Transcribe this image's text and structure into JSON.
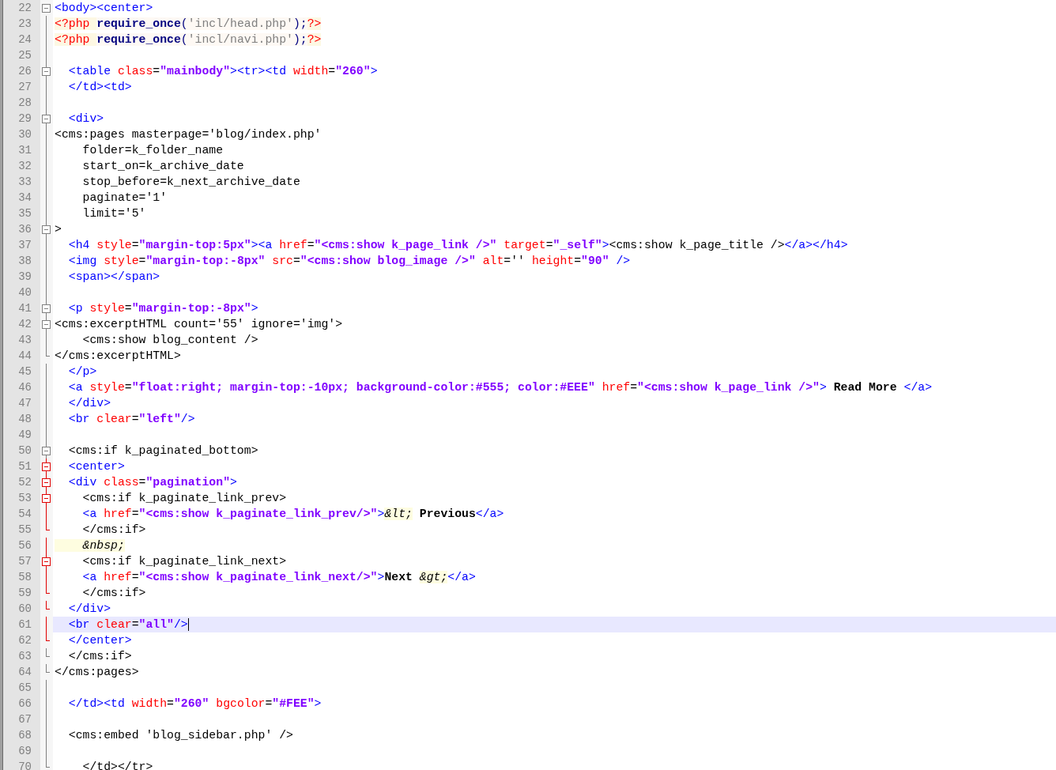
{
  "editor": {
    "lines": [
      {
        "number": "22",
        "fold": {
          "kind": "box",
          "in_scope": false
        },
        "current": false,
        "tokens": [
          {
            "kind": "tag",
            "text": "<body><center>"
          }
        ]
      },
      {
        "number": "23",
        "fold": {
          "kind": "line",
          "in_scope": false
        },
        "current": false,
        "tokens": [
          {
            "kind": "php",
            "text": "<?php "
          },
          {
            "kind": "keyword",
            "text": "require_once"
          },
          {
            "kind": "phpop",
            "text": "("
          },
          {
            "kind": "phpstr",
            "text": "'incl/head.php'"
          },
          {
            "kind": "phpop",
            "text": ");"
          },
          {
            "kind": "php",
            "text": "?>"
          }
        ]
      },
      {
        "number": "24",
        "fold": {
          "kind": "line",
          "in_scope": false
        },
        "current": false,
        "tokens": [
          {
            "kind": "php",
            "text": "<?php "
          },
          {
            "kind": "keyword",
            "text": "require_once"
          },
          {
            "kind": "phpop",
            "text": "("
          },
          {
            "kind": "phpstr",
            "text": "'incl/navi.php'"
          },
          {
            "kind": "phpop",
            "text": ");"
          },
          {
            "kind": "php",
            "text": "?>"
          }
        ]
      },
      {
        "number": "25",
        "fold": {
          "kind": "line",
          "in_scope": false
        },
        "current": false
      },
      {
        "number": "26",
        "fold": {
          "kind": "box",
          "in_scope": false
        },
        "current": false,
        "tokens": [
          {
            "kind": "tag",
            "text": "  <table"
          },
          {
            "kind": "attr",
            "text": " class"
          },
          {
            "kind": "text",
            "text": "="
          },
          {
            "kind": "str",
            "text": "\"mainbody\""
          },
          {
            "kind": "tag",
            "text": "><tr><td"
          },
          {
            "kind": "attr",
            "text": " width"
          },
          {
            "kind": "text",
            "text": "="
          },
          {
            "kind": "str",
            "text": "\"260\""
          },
          {
            "kind": "tag",
            "text": ">"
          }
        ]
      },
      {
        "number": "27",
        "fold": {
          "kind": "line",
          "in_scope": false
        },
        "current": false,
        "tokens": [
          {
            "kind": "tag",
            "text": "  </td><td>"
          }
        ]
      },
      {
        "number": "28",
        "fold": {
          "kind": "line",
          "in_scope": false
        },
        "current": false
      },
      {
        "number": "29",
        "fold": {
          "kind": "box",
          "in_scope": false
        },
        "current": false,
        "tokens": [
          {
            "kind": "tag",
            "text": "  <div>"
          }
        ]
      },
      {
        "number": "30",
        "fold": {
          "kind": "line",
          "in_scope": false
        },
        "current": false,
        "tokens": [
          {
            "kind": "text",
            "text": "<cms:pages masterpage='blog/index.php'"
          }
        ]
      },
      {
        "number": "31",
        "fold": {
          "kind": "line",
          "in_scope": false
        },
        "current": false,
        "tokens": [
          {
            "kind": "text",
            "text": "    folder=k_folder_name"
          }
        ]
      },
      {
        "number": "32",
        "fold": {
          "kind": "line",
          "in_scope": false
        },
        "current": false,
        "tokens": [
          {
            "kind": "text",
            "text": "    start_on=k_archive_date"
          }
        ]
      },
      {
        "number": "33",
        "fold": {
          "kind": "line",
          "in_scope": false
        },
        "current": false,
        "tokens": [
          {
            "kind": "text",
            "text": "    stop_before=k_next_archive_date"
          }
        ]
      },
      {
        "number": "34",
        "fold": {
          "kind": "line",
          "in_scope": false
        },
        "current": false,
        "tokens": [
          {
            "kind": "text",
            "text": "    paginate='1'"
          }
        ]
      },
      {
        "number": "35",
        "fold": {
          "kind": "line",
          "in_scope": false
        },
        "current": false,
        "tokens": [
          {
            "kind": "text",
            "text": "    limit='5'"
          }
        ]
      },
      {
        "number": "36",
        "fold": {
          "kind": "box",
          "in_scope": false
        },
        "current": false,
        "tokens": [
          {
            "kind": "text",
            "text": ">"
          }
        ]
      },
      {
        "number": "37",
        "fold": {
          "kind": "line",
          "in_scope": false
        },
        "current": false,
        "tokens": [
          {
            "kind": "tag",
            "text": "  <h4"
          },
          {
            "kind": "attr",
            "text": " style"
          },
          {
            "kind": "text",
            "text": "="
          },
          {
            "kind": "str",
            "text": "\"margin-top:5px\""
          },
          {
            "kind": "tag",
            "text": "><a"
          },
          {
            "kind": "attr",
            "text": " href"
          },
          {
            "kind": "text",
            "text": "="
          },
          {
            "kind": "str",
            "text": "\"<cms:show k_page_link />\""
          },
          {
            "kind": "attr",
            "text": " target"
          },
          {
            "kind": "text",
            "text": "="
          },
          {
            "kind": "str",
            "text": "\"_self\""
          },
          {
            "kind": "tag",
            "text": ">"
          },
          {
            "kind": "text",
            "text": "<cms:show k_page_title />"
          },
          {
            "kind": "tag",
            "text": "</a></h4>"
          }
        ]
      },
      {
        "number": "38",
        "fold": {
          "kind": "line",
          "in_scope": false
        },
        "current": false,
        "tokens": [
          {
            "kind": "tag",
            "text": "  <img"
          },
          {
            "kind": "attr",
            "text": " style"
          },
          {
            "kind": "text",
            "text": "="
          },
          {
            "kind": "str",
            "text": "\"margin-top:-8px\""
          },
          {
            "kind": "attr",
            "text": " src"
          },
          {
            "kind": "text",
            "text": "="
          },
          {
            "kind": "str",
            "text": "\"<cms:show blog_image />\""
          },
          {
            "kind": "attr",
            "text": " alt"
          },
          {
            "kind": "text",
            "text": "=''"
          },
          {
            "kind": "attr",
            "text": " height"
          },
          {
            "kind": "text",
            "text": "="
          },
          {
            "kind": "str",
            "text": "\"90\""
          },
          {
            "kind": "tag",
            "text": " />"
          }
        ]
      },
      {
        "number": "39",
        "fold": {
          "kind": "line",
          "in_scope": false
        },
        "current": false,
        "tokens": [
          {
            "kind": "tag",
            "text": "  <span></span>"
          }
        ]
      },
      {
        "number": "40",
        "fold": {
          "kind": "line",
          "in_scope": false
        },
        "current": false
      },
      {
        "number": "41",
        "fold": {
          "kind": "box",
          "in_scope": false
        },
        "current": false,
        "tokens": [
          {
            "kind": "tag",
            "text": "  <p"
          },
          {
            "kind": "attr",
            "text": " style"
          },
          {
            "kind": "text",
            "text": "="
          },
          {
            "kind": "str",
            "text": "\"margin-top:-8px\""
          },
          {
            "kind": "tag",
            "text": ">"
          }
        ]
      },
      {
        "number": "42",
        "fold": {
          "kind": "box",
          "in_scope": false
        },
        "current": false,
        "tokens": [
          {
            "kind": "text",
            "text": "<cms:excerptHTML count='55' ignore='img'>"
          }
        ]
      },
      {
        "number": "43",
        "fold": {
          "kind": "line",
          "in_scope": false
        },
        "current": false,
        "tokens": [
          {
            "kind": "text",
            "text": "    <cms:show blog_content />"
          }
        ]
      },
      {
        "number": "44",
        "fold": {
          "kind": "end",
          "in_scope": false
        },
        "current": false,
        "tokens": [
          {
            "kind": "text",
            "text": "</cms:excerptHTML>"
          }
        ]
      },
      {
        "number": "45",
        "fold": {
          "kind": "line",
          "in_scope": false
        },
        "current": false,
        "tokens": [
          {
            "kind": "tag",
            "text": "  </p>"
          }
        ]
      },
      {
        "number": "46",
        "fold": {
          "kind": "line",
          "in_scope": false
        },
        "current": false,
        "tokens": [
          {
            "kind": "tag",
            "text": "  <a"
          },
          {
            "kind": "attr",
            "text": " style"
          },
          {
            "kind": "text",
            "text": "="
          },
          {
            "kind": "str",
            "text": "\"float:right; margin-top:-10px; background-color:#555; color:#EEE\""
          },
          {
            "kind": "attr",
            "text": " href"
          },
          {
            "kind": "text",
            "text": "="
          },
          {
            "kind": "str",
            "text": "\"<cms:show k_page_link />\""
          },
          {
            "kind": "tag",
            "text": ">"
          },
          {
            "kind": "bold",
            "text": " Read More "
          },
          {
            "kind": "tag",
            "text": "</a>"
          }
        ]
      },
      {
        "number": "47",
        "fold": {
          "kind": "line",
          "in_scope": false
        },
        "current": false,
        "tokens": [
          {
            "kind": "tag",
            "text": "  </div>"
          }
        ]
      },
      {
        "number": "48",
        "fold": {
          "kind": "line",
          "in_scope": false
        },
        "current": false,
        "tokens": [
          {
            "kind": "tag",
            "text": "  <br"
          },
          {
            "kind": "attr",
            "text": " clear"
          },
          {
            "kind": "text",
            "text": "="
          },
          {
            "kind": "str",
            "text": "\"left\""
          },
          {
            "kind": "tag",
            "text": "/>"
          }
        ]
      },
      {
        "number": "49",
        "fold": {
          "kind": "line",
          "in_scope": false
        },
        "current": false
      },
      {
        "number": "50",
        "fold": {
          "kind": "box",
          "in_scope": false
        },
        "current": false,
        "tokens": [
          {
            "kind": "text",
            "text": "  <cms:if k_paginated_bottom>"
          }
        ]
      },
      {
        "number": "51",
        "fold": {
          "kind": "box",
          "in_scope": true
        },
        "current": false,
        "tokens": [
          {
            "kind": "tag",
            "text": "  <center>"
          }
        ]
      },
      {
        "number": "52",
        "fold": {
          "kind": "box",
          "in_scope": true
        },
        "current": false,
        "tokens": [
          {
            "kind": "tag",
            "text": "  <div"
          },
          {
            "kind": "attr",
            "text": " class"
          },
          {
            "kind": "text",
            "text": "="
          },
          {
            "kind": "str",
            "text": "\"pagination\""
          },
          {
            "kind": "tag",
            "text": ">"
          }
        ]
      },
      {
        "number": "53",
        "fold": {
          "kind": "box",
          "in_scope": true
        },
        "current": false,
        "tokens": [
          {
            "kind": "text",
            "text": "    <cms:if k_paginate_link_prev>"
          }
        ]
      },
      {
        "number": "54",
        "fold": {
          "kind": "line",
          "in_scope": true
        },
        "current": false,
        "tokens": [
          {
            "kind": "tag",
            "text": "    <a"
          },
          {
            "kind": "attr",
            "text": " href"
          },
          {
            "kind": "text",
            "text": "="
          },
          {
            "kind": "str",
            "text": "\"<cms:show k_paginate_link_prev/>\""
          },
          {
            "kind": "tag",
            "text": ">"
          },
          {
            "kind": "entity",
            "text": "&lt;"
          },
          {
            "kind": "bold",
            "text": " Previous"
          },
          {
            "kind": "tag",
            "text": "</a>"
          }
        ]
      },
      {
        "number": "55",
        "fold": {
          "kind": "end",
          "in_scope": true
        },
        "current": false,
        "tokens": [
          {
            "kind": "text",
            "text": "    </cms:if>"
          }
        ]
      },
      {
        "number": "56",
        "fold": {
          "kind": "line",
          "in_scope": true
        },
        "current": false,
        "tokens": [
          {
            "kind": "entity",
            "text": "    &nbsp;"
          }
        ]
      },
      {
        "number": "57",
        "fold": {
          "kind": "box",
          "in_scope": true
        },
        "current": false,
        "tokens": [
          {
            "kind": "text",
            "text": "    <cms:if k_paginate_link_next>"
          }
        ]
      },
      {
        "number": "58",
        "fold": {
          "kind": "line",
          "in_scope": true
        },
        "current": false,
        "tokens": [
          {
            "kind": "tag",
            "text": "    <a"
          },
          {
            "kind": "attr",
            "text": " href"
          },
          {
            "kind": "text",
            "text": "="
          },
          {
            "kind": "str",
            "text": "\"<cms:show k_paginate_link_next/>\""
          },
          {
            "kind": "tag",
            "text": ">"
          },
          {
            "kind": "bold",
            "text": "Next "
          },
          {
            "kind": "entity",
            "text": "&gt;"
          },
          {
            "kind": "tag",
            "text": "</a>"
          }
        ]
      },
      {
        "number": "59",
        "fold": {
          "kind": "end",
          "in_scope": true
        },
        "current": false,
        "tokens": [
          {
            "kind": "text",
            "text": "    </cms:if>"
          }
        ]
      },
      {
        "number": "60",
        "fold": {
          "kind": "end",
          "in_scope": true
        },
        "current": false,
        "tokens": [
          {
            "kind": "tag",
            "text": "  </div>"
          }
        ]
      },
      {
        "number": "61",
        "fold": {
          "kind": "line",
          "in_scope": true
        },
        "current": true,
        "tokens": [
          {
            "kind": "tag",
            "text": "  <br"
          },
          {
            "kind": "attr",
            "text": " clear"
          },
          {
            "kind": "text",
            "text": "="
          },
          {
            "kind": "str",
            "text": "\"all\""
          },
          {
            "kind": "tag",
            "text": "/>"
          }
        ]
      },
      {
        "number": "62",
        "fold": {
          "kind": "end",
          "in_scope": true
        },
        "current": false,
        "tokens": [
          {
            "kind": "tag",
            "text": "  </center>"
          }
        ]
      },
      {
        "number": "63",
        "fold": {
          "kind": "end",
          "in_scope": false
        },
        "current": false,
        "tokens": [
          {
            "kind": "text",
            "text": "  </cms:if>"
          }
        ]
      },
      {
        "number": "64",
        "fold": {
          "kind": "end",
          "in_scope": false
        },
        "current": false,
        "tokens": [
          {
            "kind": "text",
            "text": "</cms:pages>"
          }
        ]
      },
      {
        "number": "65",
        "fold": {
          "kind": "line",
          "in_scope": false
        },
        "current": false
      },
      {
        "number": "66",
        "fold": {
          "kind": "line",
          "in_scope": false
        },
        "current": false,
        "tokens": [
          {
            "kind": "tag",
            "text": "  </td><td"
          },
          {
            "kind": "attr",
            "text": " width"
          },
          {
            "kind": "text",
            "text": "="
          },
          {
            "kind": "str",
            "text": "\"260\""
          },
          {
            "kind": "attr",
            "text": " bgcolor"
          },
          {
            "kind": "text",
            "text": "="
          },
          {
            "kind": "str",
            "text": "\"#FEE\""
          },
          {
            "kind": "tag",
            "text": ">"
          }
        ]
      },
      {
        "number": "67",
        "fold": {
          "kind": "line",
          "in_scope": false
        },
        "current": false
      },
      {
        "number": "68",
        "fold": {
          "kind": "line",
          "in_scope": false
        },
        "current": false,
        "tokens": [
          {
            "kind": "text",
            "text": "  <cms:embed 'blog_sidebar.php' />"
          }
        ]
      },
      {
        "number": "69",
        "fold": {
          "kind": "line",
          "in_scope": false
        },
        "current": false
      },
      {
        "number": "70",
        "fold": {
          "kind": "end",
          "in_scope": false
        },
        "current": false,
        "tokens": [
          {
            "kind": "text",
            "text": "    </td></tr>"
          }
        ]
      }
    ]
  }
}
